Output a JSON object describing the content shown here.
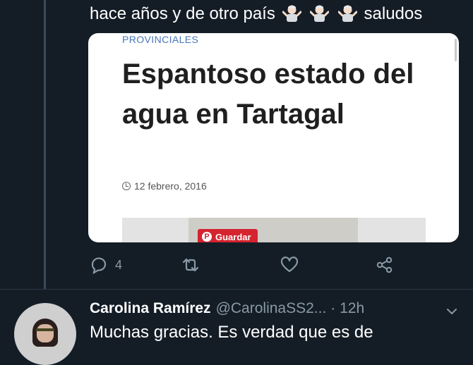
{
  "tweet": {
    "text_before": "hace años y de otro país",
    "emoji": [
      "person-shrugging",
      "person-shrugging",
      "person-shrugging"
    ],
    "text_after": "saludos"
  },
  "card": {
    "category": "PROVINCIALES",
    "headline": "Espantoso estado del agua en Tartagal",
    "date": "12 febrero, 2016",
    "pin_label": "Guardar"
  },
  "actions": {
    "reply_count": "4",
    "retweet_count": "",
    "like_count": ""
  },
  "reply": {
    "author_name": "Carolina Ramírez",
    "author_handle": "@CarolinaSS2...",
    "time": "· 12h",
    "text": "Muchas gracias. Es verdad que es de"
  },
  "colors": {
    "background": "#141d26",
    "muted": "#8899a6",
    "link_blue": "#4a76b8",
    "pinterest_red": "#d5232f"
  }
}
